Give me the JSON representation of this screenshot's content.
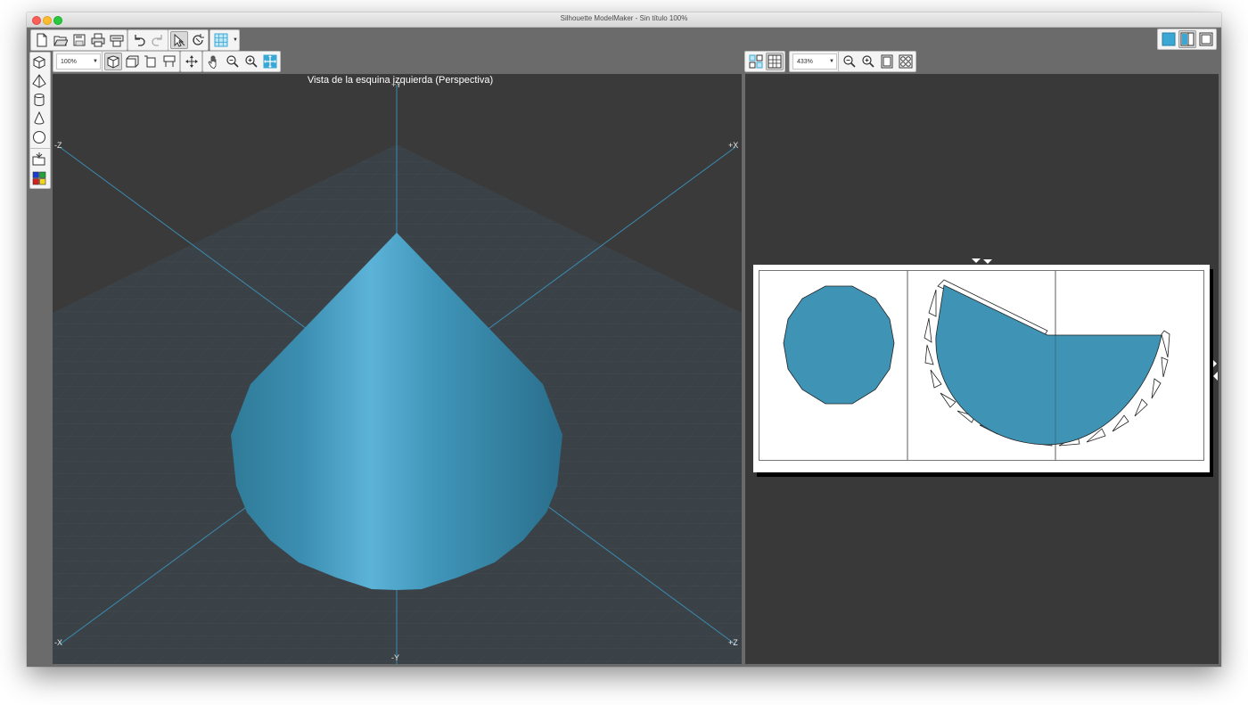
{
  "window": {
    "title": "Silhouette ModelMaker - Sin título 100%"
  },
  "toolbar_left": {
    "zoom_value": "100%"
  },
  "toolbar_right": {
    "zoom_value": "433%"
  },
  "view3d": {
    "title": "Vista de la esquina izquierda (Perspectiva)",
    "axis_labels": {
      "plus_y": "+Y",
      "minus_y": "-Y",
      "plus_x": "+X",
      "minus_x": "-X",
      "plus_z": "+Z",
      "minus_z": "-Z"
    },
    "shape": "cone"
  },
  "colors": {
    "shape_blue": "#3f94b6",
    "accent_button": "#3aa7d4",
    "viewport_bg": "#3a3a3a",
    "axis_line": "#3a8bb0"
  },
  "icons": {
    "new": "new-file-icon",
    "open": "open-folder-icon",
    "save": "save-icon",
    "print": "print-icon",
    "cut": "cutter-icon",
    "undo": "undo-icon",
    "redo": "redo-icon",
    "select": "select-arrow-icon",
    "rotate": "rotate-icon",
    "grid": "grid-icon"
  }
}
